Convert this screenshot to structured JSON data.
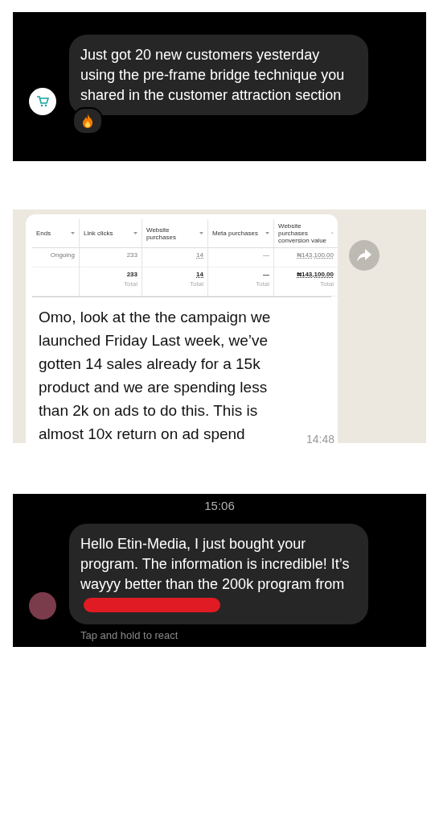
{
  "dm_top": {
    "message": "Just got 20 new customers yesterday using the pre-frame bridge technique you shared in the customer attraction section",
    "reaction": true
  },
  "whatsapp": {
    "table": {
      "columns": [
        "Ends",
        "Link clicks",
        "Website purchases",
        "Meta purchases",
        "Website purchases conversion value"
      ],
      "rows": [
        {
          "cells": [
            "Ongoing",
            "233",
            "14",
            "—",
            "₦143,100.00"
          ]
        }
      ],
      "totals": [
        {
          "value": "233",
          "label": "Total"
        },
        {
          "value": "14",
          "label": "Total"
        },
        {
          "value": "—",
          "label": "Total"
        },
        {
          "value": "₦143,100.00",
          "label": "Total"
        }
      ]
    },
    "message": "Omo, look at the the campaign we launched Friday Last week, we’ve gotten 14 sales already for a 15k product and we are spending less than 2k on ads to do this. This is almost 10x return on ad spend",
    "time": "14:48"
  },
  "dm_bottom": {
    "timestamp": "15:06",
    "message": "Hello Etin-Media, I just bought your program. The information is incredible! It’s wayyy better than the 200k program from",
    "redacted": true,
    "hint": "Tap and hold to react"
  }
}
